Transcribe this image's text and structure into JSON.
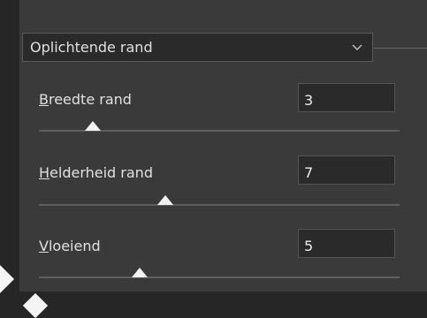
{
  "dropdown": {
    "value": "Oplichtende rand",
    "icon": "chevron-down-icon"
  },
  "params": [
    {
      "label_underlined": "B",
      "label_rest": "reedte rand",
      "value": "3",
      "slider_fraction": 0.15
    },
    {
      "label_underlined": "H",
      "label_rest": "elderheid rand",
      "value": "7",
      "slider_fraction": 0.35
    },
    {
      "label_underlined": "V",
      "label_rest": "loeiend",
      "value": "5",
      "slider_fraction": 0.28
    }
  ]
}
